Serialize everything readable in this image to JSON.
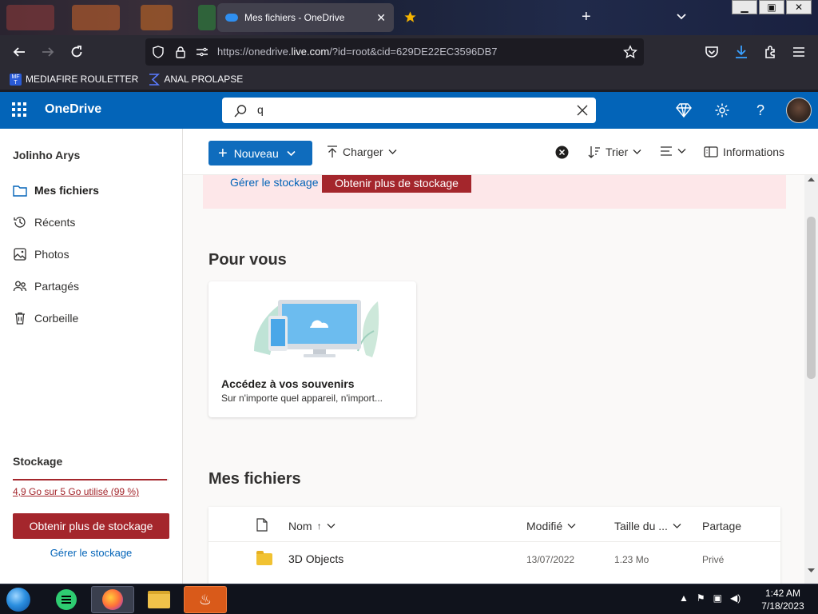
{
  "browser": {
    "active_tab_title": "Mes fichiers - OneDrive",
    "url": "https://onedrive.live.com/?id=root&cid=629DE22EC3596DB7",
    "url_prefix": "https://onedrive.",
    "url_domain": "live.com",
    "url_path": "/?id=root&cid=629DE22EC3596DB7",
    "bookmarks": [
      {
        "label": "MEDIAFIRE ROULETTER",
        "icon": "mediafire-icon"
      },
      {
        "label": "ANAL PROLAPSE",
        "icon": "sigma-icon"
      }
    ]
  },
  "header": {
    "app_name": "OneDrive",
    "search_value": "q",
    "accent": "#0364b8"
  },
  "sidebar": {
    "user_name": "Jolinho Arys",
    "items": [
      {
        "label": "Mes fichiers",
        "icon": "folder-icon",
        "active": true
      },
      {
        "label": "Récents",
        "icon": "history-icon",
        "active": false
      },
      {
        "label": "Photos",
        "icon": "image-icon",
        "active": false
      },
      {
        "label": "Partagés",
        "icon": "people-icon",
        "active": false
      },
      {
        "label": "Corbeille",
        "icon": "trash-icon",
        "active": false
      }
    ],
    "storage_title": "Stockage",
    "storage_usage": "4,9 Go sur 5 Go utilisé (99 %)",
    "storage_fraction": 0.99,
    "get_more_label": "Obtenir plus de stockage",
    "manage_label": "Gérer le stockage",
    "warning_color": "#a4262c"
  },
  "toolbar": {
    "new_label": "Nouveau",
    "upload_label": "Charger",
    "sort_label": "Trier",
    "info_label": "Informations"
  },
  "banner": {
    "manage_label": "Gérer le stockage",
    "get_more_label": "Obtenir plus de stockage"
  },
  "for_you": {
    "title": "Pour vous",
    "card_title": "Accédez à vos souvenirs",
    "card_subtitle": "Sur n'importe quel appareil, n'import..."
  },
  "files": {
    "title": "Mes fichiers",
    "columns": {
      "name": "Nom",
      "modified": "Modifié",
      "size": "Taille du ...",
      "sharing": "Partage"
    },
    "rows": [
      {
        "name": "3D Objects",
        "modified": "13/07/2022",
        "size": "1.23 Mo",
        "sharing": "Privé"
      }
    ]
  },
  "taskbar": {
    "time": "1:42 AM",
    "date": "7/18/2023"
  }
}
